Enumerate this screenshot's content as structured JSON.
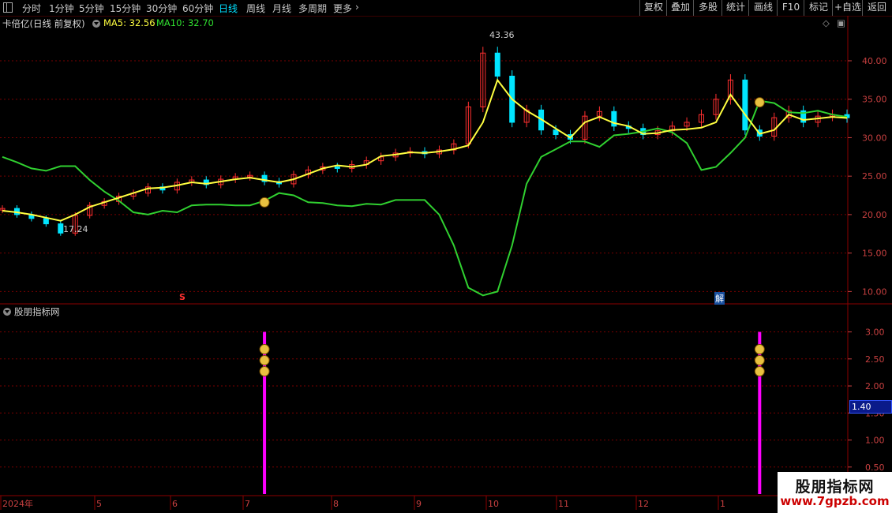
{
  "toolbar": {
    "periods": [
      "分时",
      "1分钟",
      "5分钟",
      "15分钟",
      "30分钟",
      "60分钟",
      "日线",
      "周线",
      "月线",
      "多周期",
      "更多"
    ],
    "active_period": "日线",
    "right_buttons": [
      "复权",
      "叠加",
      "多股",
      "统计",
      "画线",
      "F10",
      "标记",
      "+自选",
      "返回"
    ]
  },
  "main_panel": {
    "title": "卡倍亿(日线 前复权)",
    "ma5_label": "MA5: 32.56",
    "ma10_label": "MA10: 32.70",
    "high_marker": "43.36",
    "low_marker": "17.24",
    "signal_s": "S",
    "signal_jie": "解"
  },
  "sub_panel": {
    "title": "股朋指标网",
    "current_value": "1.40"
  },
  "watermark": {
    "line1": "股朋指标网",
    "line2": "www.7gpzb.com"
  },
  "colors": {
    "up": "#ff3030",
    "down": "#00e5ff",
    "ma5": "#ffff40",
    "green_line": "#30d030",
    "indicator": "#ff00ff",
    "grid": "#7a0000"
  },
  "chart_data": [
    {
      "type": "candlestick",
      "title": "卡倍亿(日线 前复权)",
      "y_ticks": [
        10.0,
        15.0,
        20.0,
        25.0,
        30.0,
        35.0,
        40.0
      ],
      "ylim": [
        8.5,
        44
      ],
      "x_month_labels": [
        "2024年",
        "5",
        "6",
        "7",
        "8",
        "9",
        "10",
        "11",
        "12",
        "1"
      ],
      "series": [
        {
          "name": "MA5",
          "values": [
            20.5,
            20.3,
            20.0,
            19.6,
            19.2,
            20.0,
            21.0,
            21.6,
            22.2,
            22.8,
            23.4,
            23.5,
            23.8,
            24.2,
            24.0,
            24.3,
            24.6,
            24.8,
            24.5,
            24.2,
            24.6,
            25.3,
            26.0,
            26.4,
            26.2,
            26.5,
            27.6,
            27.8,
            28.1,
            28.0,
            28.2,
            28.5,
            29.0,
            32.0,
            37.5,
            35.0,
            33.5,
            32.4,
            31.2,
            30.0,
            32.0,
            32.7,
            31.9,
            31.5,
            30.5,
            30.6,
            31.0,
            31.1,
            31.3,
            32.0,
            35.6,
            33.0,
            30.5,
            31.0,
            33.0,
            32.3,
            32.5,
            32.7,
            32.56
          ]
        },
        {
          "name": "MA10",
          "values": [
            27.5,
            26.8,
            26.0,
            25.7,
            26.3,
            26.3,
            24.5,
            23.0,
            21.8,
            20.3,
            20.0,
            20.5,
            20.3,
            21.2,
            21.3,
            21.3,
            21.2,
            21.2,
            21.8,
            22.8,
            22.5,
            21.6,
            21.5,
            21.2,
            21.1,
            21.4,
            21.3,
            21.9,
            21.9,
            21.9,
            20.0,
            16.0,
            10.5,
            9.5,
            10.0,
            16.0,
            24.0,
            27.5,
            28.5,
            29.5,
            29.5,
            28.8,
            30.3,
            30.5,
            30.8,
            31.2,
            30.7,
            29.3,
            25.8,
            26.2,
            28.0,
            30.0,
            34.8,
            34.5,
            33.3,
            33.2,
            33.5,
            33.0,
            32.7
          ]
        },
        {
          "name": "close",
          "values": [
            20.8,
            20.0,
            19.5,
            18.8,
            17.6,
            19.9,
            21.2,
            21.7,
            22.4,
            22.8,
            23.6,
            23.2,
            24.2,
            24.5,
            23.9,
            24.6,
            24.9,
            25.1,
            24.3,
            24.0,
            25.2,
            25.8,
            26.2,
            26.0,
            26.5,
            27.0,
            27.5,
            28.0,
            28.2,
            27.9,
            28.4,
            29.2,
            34.0,
            41.0,
            38.0,
            32.0,
            33.6,
            31.0,
            30.4,
            29.8,
            32.8,
            33.4,
            31.5,
            31.2,
            30.4,
            30.9,
            31.5,
            32.0,
            33.0,
            35.0,
            37.5,
            31.0,
            30.2,
            32.6,
            33.5,
            32.0,
            32.8,
            33.0,
            32.6
          ]
        }
      ]
    },
    {
      "type": "bar",
      "title": "股朋指标网",
      "y_ticks": [
        0.5,
        1.0,
        1.5,
        2.0,
        2.5,
        3.0
      ],
      "ylim": [
        0.0,
        3.3
      ],
      "signals": [
        {
          "x_index": 18,
          "value": 3.0
        },
        {
          "x_index": 52,
          "value": 3.0
        }
      ]
    }
  ]
}
